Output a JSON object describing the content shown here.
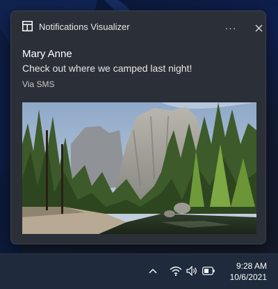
{
  "toast": {
    "app_name": "Notifications Visualizer",
    "more_label": "···",
    "sender": "Mary Anne",
    "message": "Check out where we camped last night!",
    "attribution": "Via SMS",
    "hero_image": "yosemite-valley-landscape"
  },
  "taskbar": {
    "time": "9:28 AM",
    "date": "10/6/2021",
    "icons": [
      "chevron-up-icon",
      "wifi-icon",
      "volume-icon",
      "battery-icon"
    ]
  },
  "colors": {
    "toast_background": "#2b2f38",
    "taskbar_background": "#1f2a3c",
    "desktop_accent": "#0f2050"
  }
}
